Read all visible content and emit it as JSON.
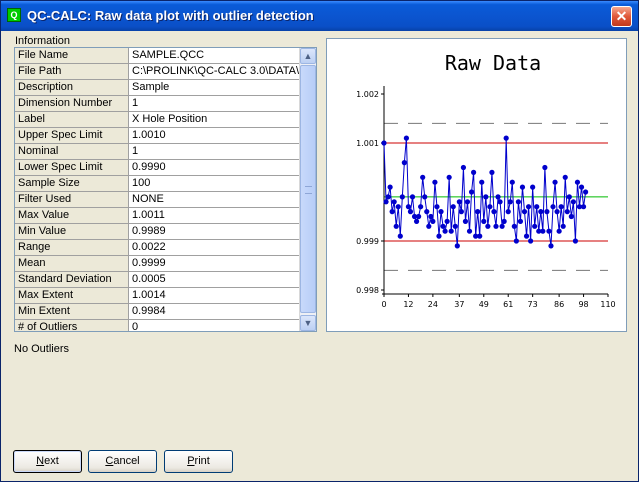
{
  "window": {
    "title": "QC-CALC: Raw data plot with outlier detection",
    "close_glyph": "✕",
    "app_icon": "qc-calc-app-icon"
  },
  "info": {
    "group_label": "Information",
    "rows": [
      {
        "name": "File Name",
        "value": "SAMPLE.QCC"
      },
      {
        "name": "File Path",
        "value": "C:\\PROLINK\\QC-CALC 3.0\\DATA\\"
      },
      {
        "name": "Description",
        "value": "Sample"
      },
      {
        "name": "Dimension Number",
        "value": "1"
      },
      {
        "name": "Label",
        "value": "X Hole Position"
      },
      {
        "name": "Upper Spec Limit",
        "value": "1.0010"
      },
      {
        "name": "Nominal",
        "value": "1"
      },
      {
        "name": "Lower Spec Limit",
        "value": "0.9990"
      },
      {
        "name": "Sample Size",
        "value": "100"
      },
      {
        "name": "Filter Used",
        "value": "NONE"
      },
      {
        "name": "Max Value",
        "value": "1.0011"
      },
      {
        "name": "Min Value",
        "value": "0.9989"
      },
      {
        "name": "Range",
        "value": "0.0022"
      },
      {
        "name": "Mean",
        "value": "0.9999"
      },
      {
        "name": "Standard Deviation",
        "value": "0.0005"
      },
      {
        "name": "Max Extent",
        "value": "1.0014"
      },
      {
        "name": "Min Extent",
        "value": "0.9984"
      },
      {
        "name": "# of Outliers",
        "value": "0"
      }
    ],
    "scroll_up_glyph": "▲",
    "scroll_down_glyph": "▼"
  },
  "status": {
    "text": "No Outliers"
  },
  "buttons": {
    "next": {
      "mnemonic": "N",
      "rest": "ext"
    },
    "cancel": {
      "mnemonic": "C",
      "rest": "ancel"
    },
    "print": {
      "mnemonic": "P",
      "rest": "rint"
    }
  },
  "chart_data": {
    "type": "line",
    "title": "Raw Data",
    "xlabel": "",
    "ylabel": "",
    "xlim": [
      0,
      110
    ],
    "ylim": [
      0.998,
      1.002
    ],
    "x_ticks": [
      "0",
      "12",
      "24",
      "37",
      "49",
      "61",
      "73",
      "86",
      "98",
      "110"
    ],
    "y_ticks": [
      "0.998",
      "0.999",
      "1.001",
      "1.002"
    ],
    "grid": false,
    "reference_lines": [
      {
        "name": "Upper Spec Limit",
        "value": 1.001,
        "color": "#cc0000",
        "style": "solid"
      },
      {
        "name": "Lower Spec Limit",
        "value": 0.999,
        "color": "#cc0000",
        "style": "solid"
      },
      {
        "name": "Mean",
        "value": 0.9999,
        "color": "#00bb00",
        "style": "solid"
      },
      {
        "name": "Max Extent",
        "value": 1.0014,
        "color": "#777777",
        "style": "dashed"
      },
      {
        "name": "Min Extent",
        "value": 0.9984,
        "color": "#777777",
        "style": "dashed"
      }
    ],
    "series": [
      {
        "color": "#0000cc",
        "values": [
          1.001,
          0.9998,
          0.9999,
          1.0001,
          0.9996,
          0.9998,
          0.9993,
          0.9997,
          0.9991,
          0.9999,
          1.0006,
          1.0011,
          0.9997,
          0.9996,
          0.9999,
          0.9995,
          0.9994,
          0.9995,
          0.9997,
          1.0003,
          0.9999,
          0.9996,
          0.9993,
          0.9995,
          0.9994,
          1.0002,
          0.9997,
          0.9991,
          0.9996,
          0.9993,
          0.9992,
          0.9994,
          1.0003,
          0.9992,
          0.9997,
          0.9993,
          0.9989,
          0.9998,
          0.9996,
          1.0005,
          0.9994,
          0.9998,
          0.9992,
          1.0,
          1.0004,
          0.9991,
          0.9996,
          0.9991,
          1.0002,
          0.9994,
          0.9999,
          0.9993,
          0.9997,
          1.0004,
          0.9996,
          0.9993,
          0.9999,
          0.9998,
          0.9993,
          0.9994,
          1.0011,
          0.9996,
          0.9998,
          1.0002,
          0.9993,
          0.999,
          0.9998,
          0.9994,
          1.0001,
          0.9996,
          0.9991,
          0.9997,
          0.999,
          1.0001,
          0.9993,
          0.9997,
          0.9992,
          0.9996,
          0.9992,
          1.0005,
          0.9996,
          0.9992,
          0.9989,
          0.9997,
          1.0002,
          0.9996,
          0.9992,
          0.9997,
          0.9993,
          1.0003,
          0.9996,
          0.9999,
          0.9995,
          0.9998,
          0.999,
          1.0002,
          0.9997,
          1.0001,
          0.9997,
          1.0
        ]
      }
    ]
  }
}
